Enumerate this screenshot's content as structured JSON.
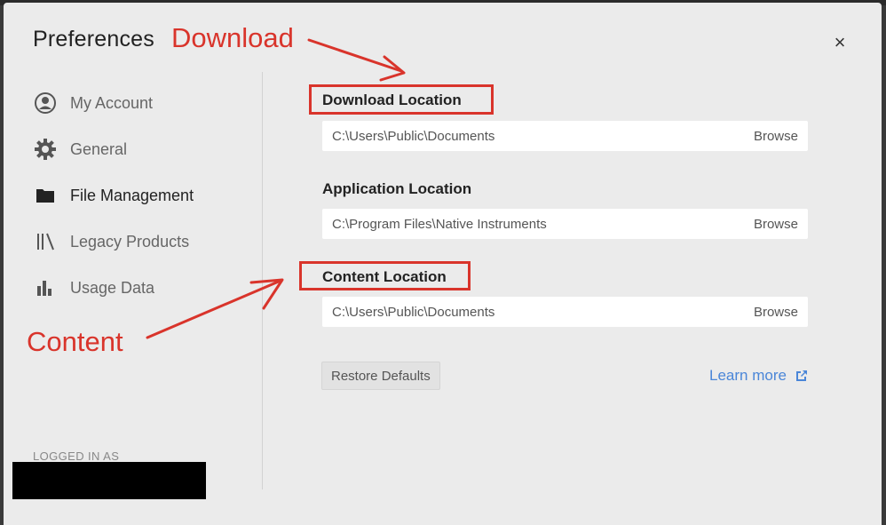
{
  "dialog": {
    "title": "Preferences",
    "close_symbol": "×"
  },
  "sidebar": {
    "items": [
      {
        "label": "My Account",
        "icon": "account-circle-icon"
      },
      {
        "label": "General",
        "icon": "gear-icon"
      },
      {
        "label": "File Management",
        "icon": "folder-icon",
        "active": true
      },
      {
        "label": "Legacy Products",
        "icon": "library-icon"
      },
      {
        "label": "Usage Data",
        "icon": "bar-chart-icon"
      }
    ],
    "logged_in_label": "LOGGED IN AS"
  },
  "main": {
    "download": {
      "label": "Download Location",
      "path": "C:\\Users\\Public\\Documents",
      "browse": "Browse"
    },
    "application": {
      "label": "Application Location",
      "path": "C:\\Program Files\\Native Instruments",
      "browse": "Browse"
    },
    "content": {
      "label": "Content Location",
      "path": "C:\\Users\\Public\\Documents",
      "browse": "Browse"
    },
    "restore_label": "Restore Defaults",
    "learn_more_label": "Learn more"
  },
  "annotations": {
    "download_text": "Download",
    "content_text": "Content",
    "color": "#d9342b"
  },
  "colors": {
    "dialog_bg": "#ebebeb",
    "link": "#4a86d8",
    "annotation": "#d9342b"
  }
}
